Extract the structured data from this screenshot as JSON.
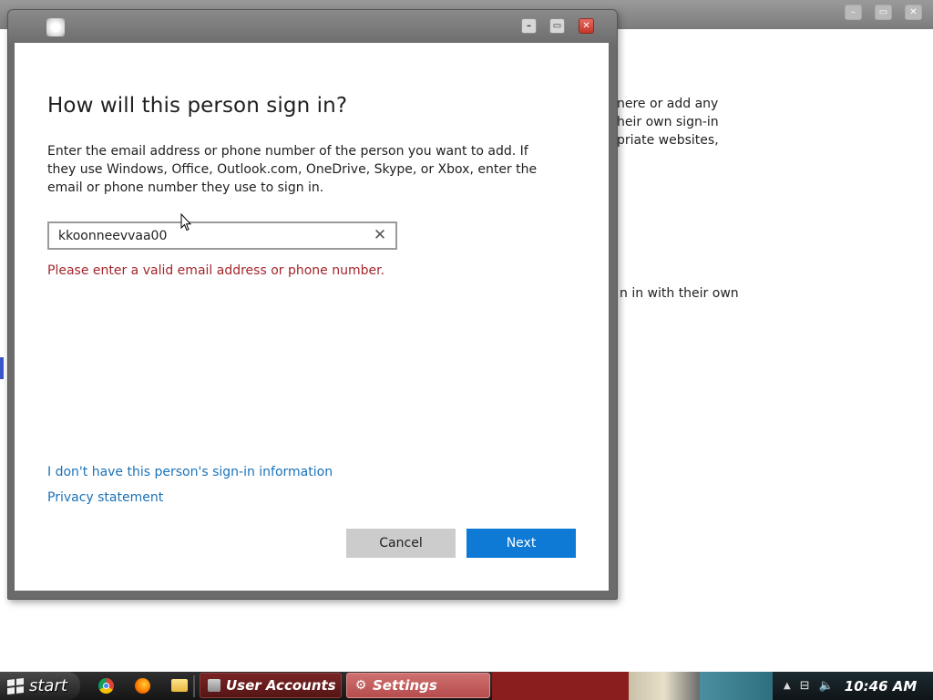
{
  "background_window": {
    "partial_text_lines": [
      "nere or add any",
      "heir own sign-in",
      "priate websites,"
    ],
    "partial_text_line2": "n in with their own"
  },
  "dialog": {
    "heading": "How will this person sign in?",
    "description": "Enter the email address or phone number of the person you want to add. If they use Windows, Office, Outlook.com, OneDrive, Skype, or Xbox, enter the email or phone number they use to sign in.",
    "input_value": "kkoonneevvaa00",
    "clear_icon": "✕",
    "error_message": "Please enter a valid email address or phone number.",
    "no_info_link": "I don't have this person's sign-in information",
    "privacy_link": "Privacy statement",
    "cancel_label": "Cancel",
    "next_label": "Next",
    "minimize_glyph": "–",
    "maximize_glyph": "▭",
    "close_glyph": "✕"
  },
  "taskbar": {
    "start_label": "start",
    "tasks": [
      {
        "label": "User Accounts"
      },
      {
        "label": "Settings"
      }
    ],
    "settings_icon": "⚙",
    "clock": "10:46 AM",
    "tray_arrow": "▲",
    "tray_network_icon": "⊟",
    "tray_volume_icon": "🔈"
  },
  "colors": {
    "accent_blue": "#0f7ad6",
    "error_red": "#a4262c",
    "link_blue": "#1a72b8",
    "cancel_gray": "#cccccc"
  }
}
